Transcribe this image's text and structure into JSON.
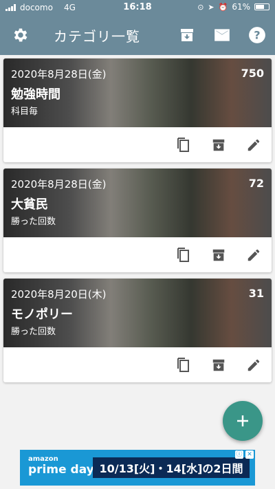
{
  "status_bar": {
    "carrier": "docomo",
    "network": "4G",
    "time": "16:18",
    "battery": "61%"
  },
  "header": {
    "title": "カテゴリ一覧",
    "left_icon": "gear-icon",
    "right_icons": [
      "archive-icon",
      "mail-icon",
      "help-icon"
    ]
  },
  "cards": [
    {
      "date": "2020年8月28日(金)",
      "count": "750",
      "name": "勉強時間",
      "subtitle": "科目毎"
    },
    {
      "date": "2020年8月28日(金)",
      "count": "72",
      "name": "大貧民",
      "subtitle": "勝った回数"
    },
    {
      "date": "2020年8月20日(木)",
      "count": "31",
      "name": "モノポリー",
      "subtitle": "勝った回数"
    }
  ],
  "card_actions": [
    "copy-icon",
    "archive-icon",
    "edit-icon"
  ],
  "fab": {
    "label": "+"
  },
  "ad": {
    "logo_line1": "amazon",
    "logo_line2": "prime day",
    "text": "10/13[火]・14[水]の2日間"
  },
  "colors": {
    "header": "#6b8a9a",
    "fab": "#3a9688",
    "ad": "#1a98d5"
  }
}
